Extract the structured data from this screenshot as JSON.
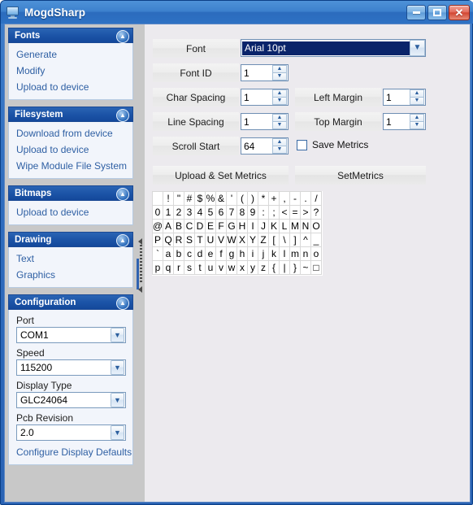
{
  "window": {
    "title": "MogdSharp",
    "icon": "monitor-icon",
    "buttons": {
      "minimize": "minimize-icon",
      "maximize": "maximize-icon",
      "close": "close-icon"
    },
    "accent_color": "#2a63b4",
    "header_color": "#1b53a6",
    "link_color": "#2e5fa3"
  },
  "sidebar": {
    "groups": [
      {
        "title": "Fonts",
        "collapse_icon": "chevron-up-icon",
        "links": [
          "Generate",
          "Modify",
          "Upload to device"
        ]
      },
      {
        "title": "Filesystem",
        "collapse_icon": "chevron-up-icon",
        "links": [
          "Download from device",
          "Upload to device",
          "Wipe Module File System"
        ]
      },
      {
        "title": "Bitmaps",
        "collapse_icon": "chevron-up-icon",
        "links": [
          "Upload to device"
        ]
      },
      {
        "title": "Drawing",
        "collapse_icon": "chevron-up-icon",
        "links": [
          "Text",
          "Graphics"
        ]
      }
    ],
    "configuration": {
      "title": "Configuration",
      "collapse_icon": "chevron-up-icon",
      "fields": [
        {
          "label": "Port",
          "value": "COM1",
          "icon": "chevron-down-icon"
        },
        {
          "label": "Speed",
          "value": "115200",
          "icon": "chevron-down-icon"
        },
        {
          "label": "Display Type",
          "value": "GLC24064",
          "icon": "chevron-down-icon"
        },
        {
          "label": "Pcb Revision",
          "value": "2.0",
          "icon": "chevron-down-icon"
        }
      ],
      "link": "Configure Display Defaults"
    }
  },
  "splitter": {
    "grip_icon": "splitter-grip-icon"
  },
  "form": {
    "font": {
      "label": "Font",
      "value": "Arial 10pt",
      "dropdown_icon": "chevron-down-icon"
    },
    "font_id": {
      "label": "Font ID",
      "value": "1"
    },
    "char_spacing": {
      "label": "Char Spacing",
      "value": "1"
    },
    "left_margin": {
      "label": "Left Margin",
      "value": "1"
    },
    "line_spacing": {
      "label": "Line Spacing",
      "value": "1"
    },
    "top_margin": {
      "label": "Top Margin",
      "value": "1"
    },
    "scroll_start": {
      "label": "Scroll Start",
      "value": "64"
    },
    "save_metrics": {
      "label": "Save Metrics",
      "checked": false
    },
    "buttons": {
      "upload_set_metrics": "Upload & Set Metrics",
      "set_metrics": "SetMetrics"
    },
    "spinner_up_icon": "spinner-up-icon",
    "spinner_down_icon": "spinner-down-icon"
  },
  "charmap": {
    "columns": 16,
    "rows": [
      [
        " ",
        "!",
        "\"",
        "#",
        "$",
        "%",
        "&",
        "'",
        "(",
        ")",
        "*",
        "+",
        ",",
        "-",
        ".",
        "/"
      ],
      [
        "0",
        "1",
        "2",
        "3",
        "4",
        "5",
        "6",
        "7",
        "8",
        "9",
        ":",
        ";",
        "<",
        "=",
        ">",
        "?"
      ],
      [
        "@",
        "A",
        "B",
        "C",
        "D",
        "E",
        "F",
        "G",
        "H",
        "I",
        "J",
        "K",
        "L",
        "M",
        "N",
        "O"
      ],
      [
        "P",
        "Q",
        "R",
        "S",
        "T",
        "U",
        "V",
        "W",
        "X",
        "Y",
        "Z",
        "[",
        "\\",
        "]",
        "^",
        "_"
      ],
      [
        "`",
        "a",
        "b",
        "c",
        "d",
        "e",
        "f",
        "g",
        "h",
        "i",
        "j",
        "k",
        "l",
        "m",
        "n",
        "o"
      ],
      [
        "p",
        "q",
        "r",
        "s",
        "t",
        "u",
        "v",
        "w",
        "x",
        "y",
        "z",
        "{",
        "|",
        "}",
        "~",
        "□"
      ]
    ]
  }
}
